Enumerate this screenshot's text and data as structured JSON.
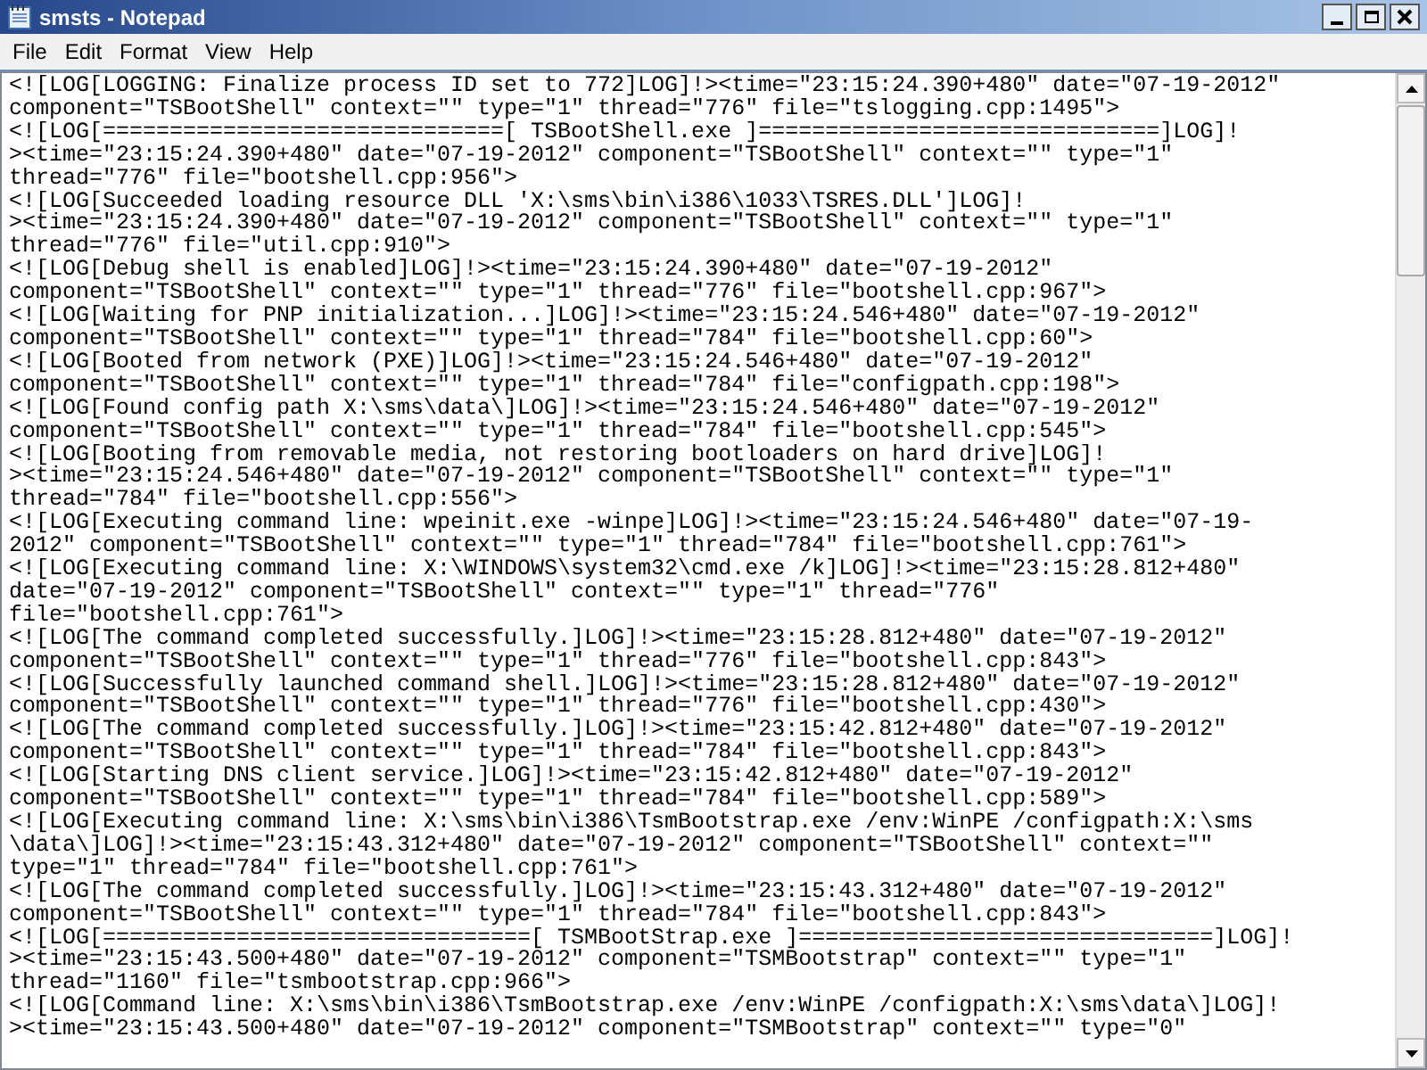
{
  "window": {
    "title": "smsts - Notepad"
  },
  "menu": [
    "File",
    "Edit",
    "Format",
    "View",
    "Help"
  ],
  "lines": [
    "<![LOG[LOGGING: Finalize process ID set to 772]LOG]!><time=\"23:15:24.390+480\" date=\"07-19-2012\"",
    "component=\"TSBootShell\" context=\"\" type=\"1\" thread=\"776\" file=\"tslogging.cpp:1495\">",
    "<![LOG[==============================[ TSBootShell.exe ]==============================]LOG]!",
    "><time=\"23:15:24.390+480\" date=\"07-19-2012\" component=\"TSBootShell\" context=\"\" type=\"1\"",
    "thread=\"776\" file=\"bootshell.cpp:956\">",
    "<![LOG[Succeeded loading resource DLL 'X:\\sms\\bin\\i386\\1033\\TSRES.DLL']LOG]!",
    "><time=\"23:15:24.390+480\" date=\"07-19-2012\" component=\"TSBootShell\" context=\"\" type=\"1\"",
    "thread=\"776\" file=\"util.cpp:910\">",
    "<![LOG[Debug shell is enabled]LOG]!><time=\"23:15:24.390+480\" date=\"07-19-2012\"",
    "component=\"TSBootShell\" context=\"\" type=\"1\" thread=\"776\" file=\"bootshell.cpp:967\">",
    "<![LOG[Waiting for PNP initialization...]LOG]!><time=\"23:15:24.546+480\" date=\"07-19-2012\"",
    "component=\"TSBootShell\" context=\"\" type=\"1\" thread=\"784\" file=\"bootshell.cpp:60\">",
    "<![LOG[Booted from network (PXE)]LOG]!><time=\"23:15:24.546+480\" date=\"07-19-2012\"",
    "component=\"TSBootShell\" context=\"\" type=\"1\" thread=\"784\" file=\"configpath.cpp:198\">",
    "<![LOG[Found config path X:\\sms\\data\\]LOG]!><time=\"23:15:24.546+480\" date=\"07-19-2012\"",
    "component=\"TSBootShell\" context=\"\" type=\"1\" thread=\"784\" file=\"bootshell.cpp:545\">",
    "<![LOG[Booting from removable media, not restoring bootloaders on hard drive]LOG]!",
    "><time=\"23:15:24.546+480\" date=\"07-19-2012\" component=\"TSBootShell\" context=\"\" type=\"1\"",
    "thread=\"784\" file=\"bootshell.cpp:556\">",
    "<![LOG[Executing command line: wpeinit.exe -winpe]LOG]!><time=\"23:15:24.546+480\" date=\"07-19-",
    "2012\" component=\"TSBootShell\" context=\"\" type=\"1\" thread=\"784\" file=\"bootshell.cpp:761\">",
    "<![LOG[Executing command line: X:\\WINDOWS\\system32\\cmd.exe /k]LOG]!><time=\"23:15:28.812+480\"",
    "date=\"07-19-2012\" component=\"TSBootShell\" context=\"\" type=\"1\" thread=\"776\"",
    "file=\"bootshell.cpp:761\">",
    "<![LOG[The command completed successfully.]LOG]!><time=\"23:15:28.812+480\" date=\"07-19-2012\"",
    "component=\"TSBootShell\" context=\"\" type=\"1\" thread=\"776\" file=\"bootshell.cpp:843\">",
    "<![LOG[Successfully launched command shell.]LOG]!><time=\"23:15:28.812+480\" date=\"07-19-2012\"",
    "component=\"TSBootShell\" context=\"\" type=\"1\" thread=\"776\" file=\"bootshell.cpp:430\">",
    "<![LOG[The command completed successfully.]LOG]!><time=\"23:15:42.812+480\" date=\"07-19-2012\"",
    "component=\"TSBootShell\" context=\"\" type=\"1\" thread=\"784\" file=\"bootshell.cpp:843\">",
    "<![LOG[Starting DNS client service.]LOG]!><time=\"23:15:42.812+480\" date=\"07-19-2012\"",
    "component=\"TSBootShell\" context=\"\" type=\"1\" thread=\"784\" file=\"bootshell.cpp:589\">",
    "<![LOG[Executing command line: X:\\sms\\bin\\i386\\TsmBootstrap.exe /env:WinPE /configpath:X:\\sms",
    "\\data\\]LOG]!><time=\"23:15:43.312+480\" date=\"07-19-2012\" component=\"TSBootShell\" context=\"\"",
    "type=\"1\" thread=\"784\" file=\"bootshell.cpp:761\">",
    "<![LOG[The command completed successfully.]LOG]!><time=\"23:15:43.312+480\" date=\"07-19-2012\"",
    "component=\"TSBootShell\" context=\"\" type=\"1\" thread=\"784\" file=\"bootshell.cpp:843\">",
    "<![LOG[================================[ TSMBootStrap.exe ]===============================]LOG]!",
    "><time=\"23:15:43.500+480\" date=\"07-19-2012\" component=\"TSMBootstrap\" context=\"\" type=\"1\"",
    "thread=\"1160\" file=\"tsmbootstrap.cpp:966\">",
    "<![LOG[Command line: X:\\sms\\bin\\i386\\TsmBootstrap.exe /env:WinPE /configpath:X:\\sms\\data\\]LOG]!",
    "><time=\"23:15:43.500+480\" date=\"07-19-2012\" component=\"TSMBootstrap\" context=\"\" type=\"0\""
  ]
}
